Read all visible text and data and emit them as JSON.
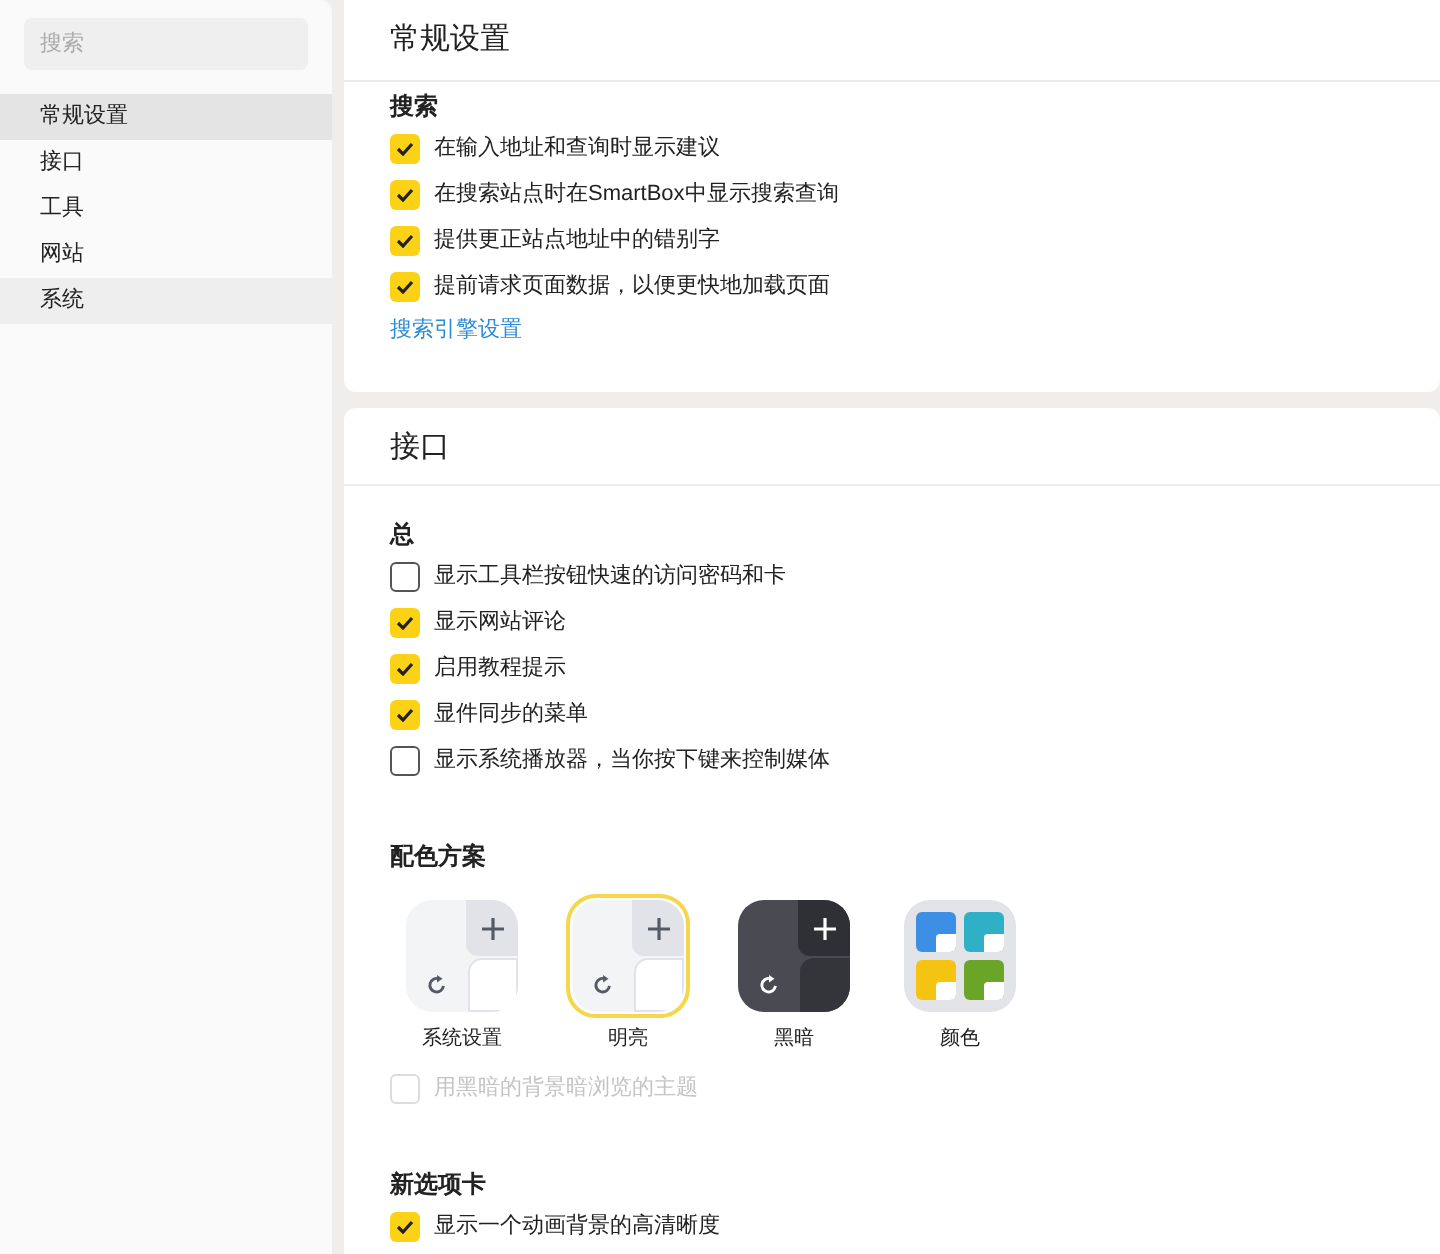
{
  "sidebar": {
    "search": {
      "placeholder": "搜索"
    },
    "items": [
      {
        "label": "常规设置",
        "selected": true,
        "hovered": false
      },
      {
        "label": "接口",
        "selected": false,
        "hovered": false
      },
      {
        "label": "工具",
        "selected": false,
        "hovered": false
      },
      {
        "label": "网站",
        "selected": false,
        "hovered": false
      },
      {
        "label": "系统",
        "selected": false,
        "hovered": true
      }
    ]
  },
  "general": {
    "title": "常规设置",
    "section": "搜索",
    "options": [
      {
        "label": "在输入地址和查询时显示建议",
        "checked": true
      },
      {
        "label": "在搜索站点时在SmartBox中显示搜索查询",
        "checked": true
      },
      {
        "label": "提供更正站点地址中的错别字",
        "checked": true
      },
      {
        "label": "提前请求页面数据，以便更快地加载页面",
        "checked": true
      }
    ],
    "link": "搜索引擎设置"
  },
  "interface": {
    "title": "接口",
    "section": "总",
    "options": [
      {
        "label": "显示工具栏按钮快速的访问密码和卡",
        "checked": false
      },
      {
        "label": "显示网站评论",
        "checked": true
      },
      {
        "label": "启用教程提示",
        "checked": true
      },
      {
        "label": "显件同步的菜单",
        "checked": true
      },
      {
        "label": "显示系统播放器，当你按下键来控制媒体",
        "checked": false
      }
    ],
    "scheme_title": "配色方案",
    "schemes": [
      {
        "kind": "system",
        "label": "系统设置",
        "selected": false
      },
      {
        "kind": "light",
        "label": "明亮",
        "selected": true
      },
      {
        "kind": "dark",
        "label": "黑暗",
        "selected": false
      },
      {
        "kind": "colors",
        "label": "颜色",
        "selected": false
      }
    ],
    "dark_option": {
      "label": "用黑暗的背景暗浏览的主题",
      "checked": false,
      "disabled": true
    },
    "newtab_title": "新选项卡",
    "newtab_options": [
      {
        "label": "显示一个动画背景的高清晰度",
        "checked": true
      }
    ]
  }
}
